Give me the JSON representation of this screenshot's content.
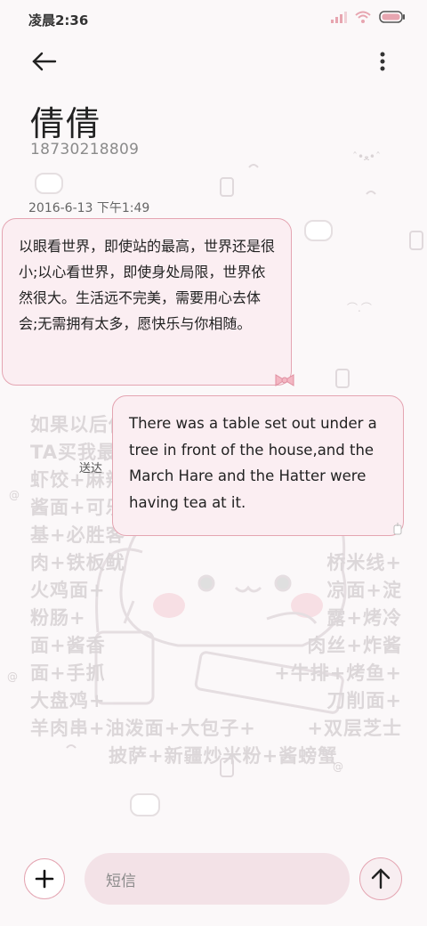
{
  "status_bar": {
    "time": "凌晨2:36",
    "signal_icon": "signal-icon",
    "wifi_icon": "wifi-icon",
    "battery_icon": "battery-icon"
  },
  "header": {
    "back_icon": "back-arrow-icon",
    "menu_icon": "more-vertical-icon",
    "contact_name": "倩倩",
    "contact_number": "18730218809"
  },
  "conversation": {
    "timestamp": "2016-6-13 下午1:49",
    "messages": [
      {
        "direction": "incoming",
        "text": "以眼看世界，即使站的最高，世界还是很小;以心看世界，即使身处局限，世界依然很大。生活远不完美，需要用心去体会;无需拥有太多，愿快乐与你相随。"
      },
      {
        "direction": "outgoing",
        "text": "There was a table set out under a tree in front of the house,and the March Hare and the Hatter were having tea at it.",
        "status": "送达"
      }
    ]
  },
  "wallpaper": {
    "lines": [
      "如果以后你想吃",
      "TA买我最爱吃的",
      "虾饺+麻辣",
      "酱面+可乐",
      "基+必胜客",
      "肉+铁板鱿",
      "火鸡面+",
      "粉肠+",
      "面+酱香",
      "面+手抓",
      "大盘鸡+",
      "羊肉串+油泼面+大包子+",
      "披萨+新疆炒米粉+酱螃蟹"
    ],
    "right_lines": [
      "桥米线+",
      "凉面+淀",
      "露+烤冷",
      "肉丝+炸酱",
      "+牛排+烤鱼+",
      "刀削面+",
      "+双层芝士"
    ]
  },
  "composer": {
    "add_icon": "plus-icon",
    "placeholder": "短信",
    "send_icon": "send-arrow-icon"
  },
  "colors": {
    "accent": "#e4a5b2",
    "bubble_bg": "#fbeef2",
    "input_bg": "#f3e2e7"
  }
}
